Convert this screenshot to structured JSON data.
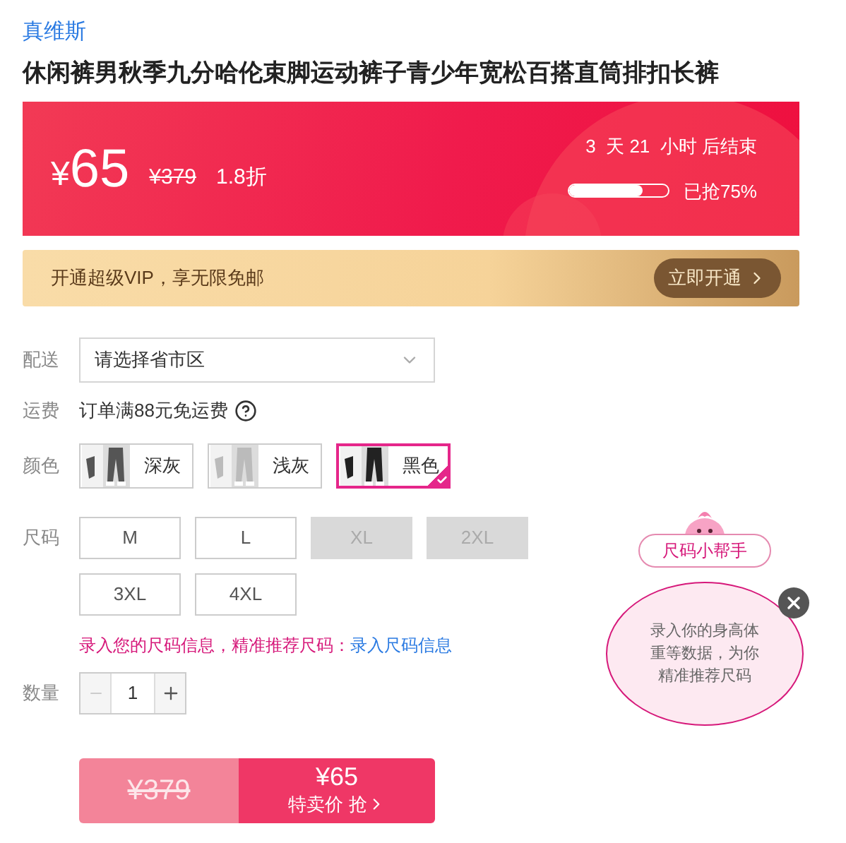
{
  "brand": "真维斯",
  "title": "休闲裤男秋季九分哈伦束脚运动裤子青少年宽松百搭直筒排扣长裤",
  "promo": {
    "currency": "¥",
    "price": "65",
    "original_price": "¥379",
    "discount": "1.8折",
    "countdown": "3  天 21  小时 后结束",
    "level": 0.75,
    "sold_label": "已抢75%"
  },
  "vip": {
    "text": "开通超级VIP，享无限免邮",
    "button": "立即开通"
  },
  "delivery": {
    "label": "配送",
    "placeholder": "请选择省市区"
  },
  "shipping": {
    "label": "运费",
    "text": "订单满88元免运费"
  },
  "colors": {
    "label": "颜色",
    "options": [
      {
        "name": "深灰",
        "selected": false
      },
      {
        "name": "浅灰",
        "selected": false
      },
      {
        "name": "黑色",
        "selected": true
      }
    ]
  },
  "sizes": {
    "label": "尺码",
    "options": [
      {
        "name": "M",
        "disabled": false
      },
      {
        "name": "L",
        "disabled": false
      },
      {
        "name": "XL",
        "disabled": true
      },
      {
        "name": "2XL",
        "disabled": true
      },
      {
        "name": "3XL",
        "disabled": false
      },
      {
        "name": "4XL",
        "disabled": false
      }
    ]
  },
  "size_hint": {
    "text": "录入您的尺码信息，精准推荐尺码：",
    "link": "录入尺码信息"
  },
  "quantity": {
    "label": "数量",
    "value": "1",
    "minus_disabled": true
  },
  "buy": {
    "original_price": "¥379",
    "price": "¥65",
    "action": "特卖价 抢"
  },
  "helper": {
    "title": "尺码小帮手",
    "message": "录入你的身高体重等数据，为你精准推荐尺码"
  }
}
